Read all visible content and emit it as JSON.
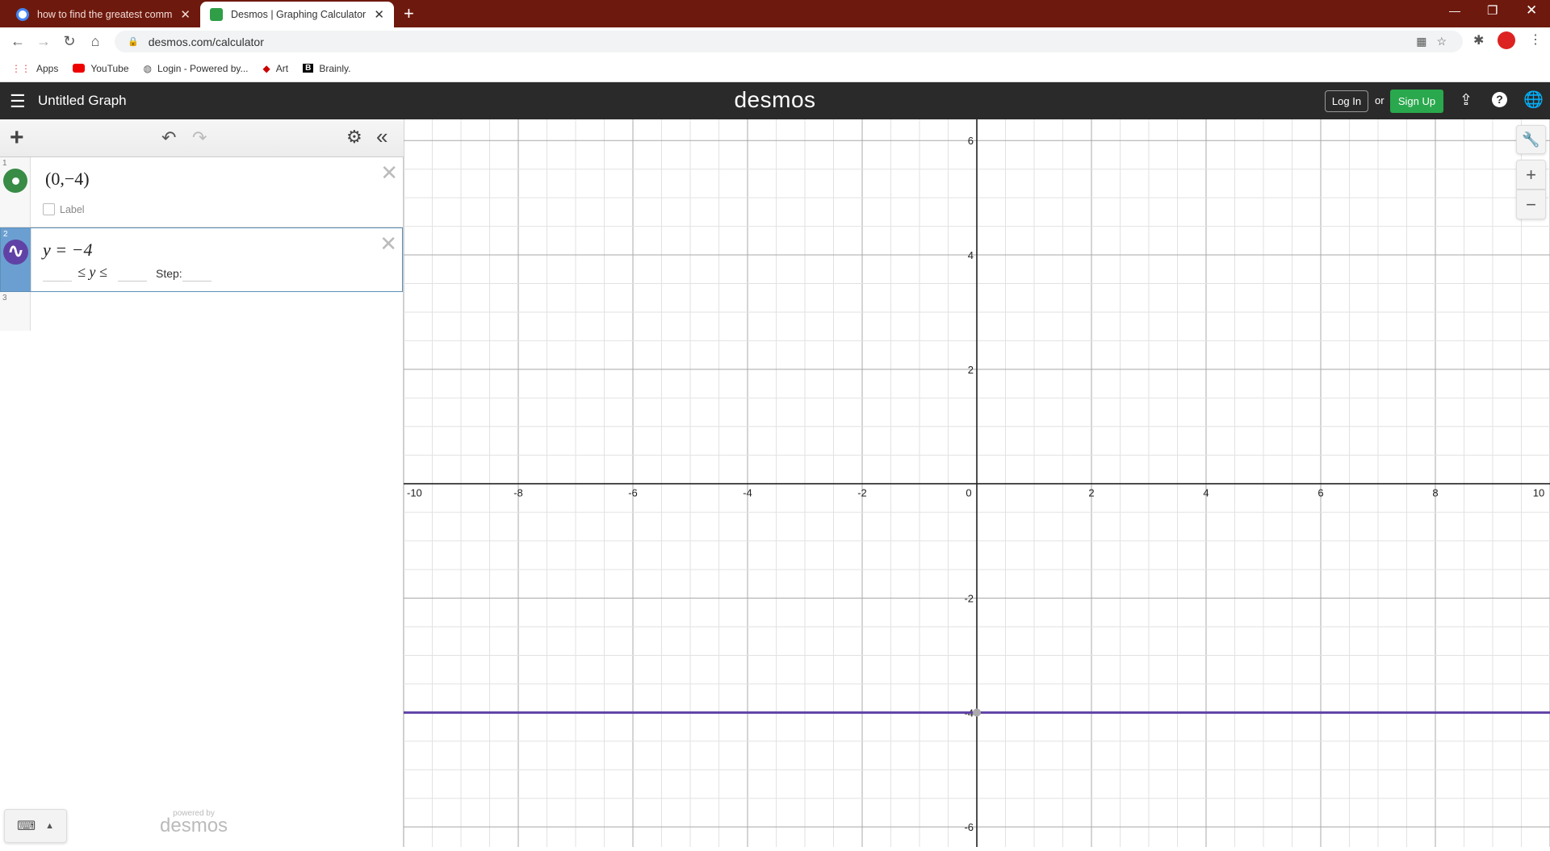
{
  "browser": {
    "tabs": [
      {
        "title": "how to find the greatest commo",
        "active": false
      },
      {
        "title": "Desmos | Graphing Calculator",
        "active": true
      }
    ],
    "url": "desmos.com/calculator",
    "bookmarks": [
      "Apps",
      "YouTube",
      "Login - Powered by...",
      "Art",
      "Brainly."
    ]
  },
  "header": {
    "title": "Untitled Graph",
    "logo": "desmos",
    "login": "Log In",
    "or": "or",
    "signup": "Sign Up"
  },
  "expressions": [
    {
      "num": "1",
      "latex": "(0,−4)",
      "label_checkbox": "Label",
      "color": "#388c46"
    },
    {
      "num": "2",
      "latex": "y = −4",
      "domain_mid": "≤ y ≤",
      "step_label": "Step:",
      "color": "#6042a6"
    },
    {
      "num": "3"
    }
  ],
  "footer": {
    "powered_by": "powered by",
    "brand": "desmos"
  },
  "chart_data": {
    "type": "line",
    "xlim": [
      -10,
      10
    ],
    "ylim": [
      -6.35,
      6.37
    ],
    "x_ticks": [
      "-10",
      "-8",
      "-6",
      "-4",
      "-2",
      "0",
      "2",
      "4",
      "6",
      "8",
      "10"
    ],
    "y_ticks": [
      "6",
      "4",
      "2",
      "-2",
      "-4",
      "-6"
    ],
    "grid": true,
    "series": [
      {
        "name": "y = -4",
        "type": "horizontal-line",
        "y": -4,
        "color": "#6042a6"
      }
    ],
    "points": [
      {
        "x": 0,
        "y": -4,
        "color": "#388c46"
      }
    ]
  }
}
